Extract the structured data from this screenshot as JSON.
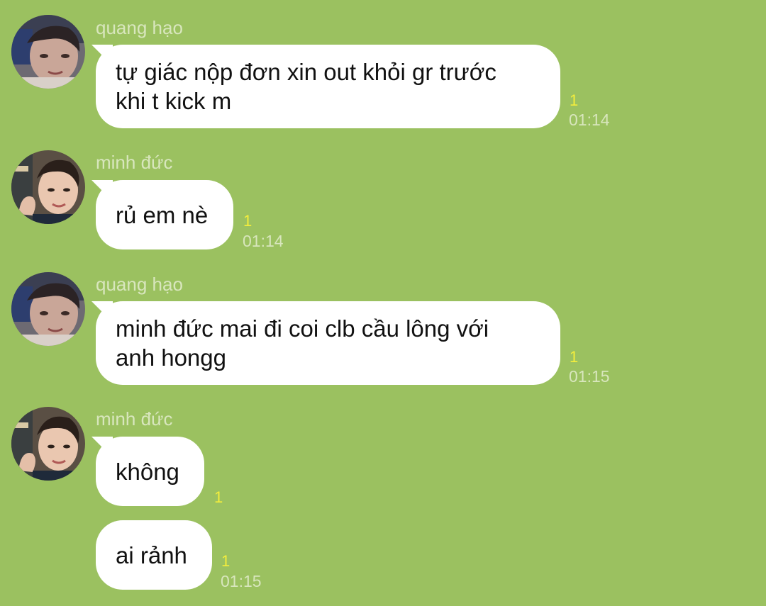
{
  "conversation": {
    "messages": [
      {
        "sender": "quang hạo",
        "lines": [
          "tự giác nộp đơn xin out khỏi gr trước",
          "khi t kick m"
        ],
        "read_count": "1",
        "time": "01:14"
      },
      {
        "sender": "minh đức",
        "lines": [
          "rủ em nè"
        ],
        "read_count": "1",
        "time": "01:14"
      },
      {
        "sender": "quang hạo",
        "lines": [
          "minh đức mai đi coi clb cầu lông với",
          "anh hongg"
        ],
        "read_count": "1",
        "time": "01:15"
      },
      {
        "sender": "minh đức",
        "lines": [
          "không"
        ],
        "read_count": "1",
        "time": ""
      },
      {
        "sender": "",
        "lines": [
          "ai rảnh"
        ],
        "read_count": "1",
        "time": "01:15"
      }
    ]
  },
  "colors": {
    "background": "#9bc160",
    "bubble": "#ffffff",
    "read_count": "#f4ee3c",
    "meta_text": "#d8e6bd"
  }
}
